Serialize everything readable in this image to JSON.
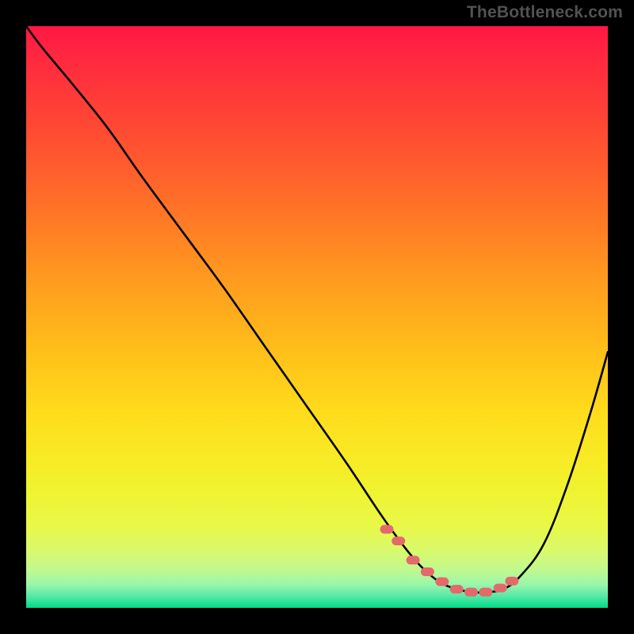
{
  "watermark": "TheBottleneck.com",
  "colors": {
    "page_bg": "#000000",
    "curve": "#000000",
    "marker": "#e36a6a",
    "gradient_top": "#ff1744",
    "gradient_bottom": "#00db87"
  },
  "chart_data": {
    "type": "line",
    "title": "",
    "xlabel": "",
    "ylabel": "",
    "xlim": [
      0,
      100
    ],
    "ylim": [
      0,
      100
    ],
    "grid": false,
    "series": [
      {
        "name": "bottleneck-curve",
        "x": [
          0,
          3,
          8,
          14,
          20,
          27,
          34,
          41,
          48,
          55,
          61,
          65,
          68,
          71,
          74,
          77,
          79,
          82,
          85,
          89,
          93,
          97,
          100
        ],
        "y": [
          100,
          96,
          90,
          82.5,
          74,
          64.5,
          55,
          45,
          35,
          25,
          16,
          10.5,
          7,
          4.5,
          3.2,
          2.7,
          2.7,
          3.2,
          5.5,
          11,
          21,
          33.5,
          44
        ]
      }
    ],
    "markers": {
      "name": "min-region",
      "x": [
        62,
        64,
        66.5,
        69,
        71.5,
        74,
        76.5,
        79,
        81.5,
        83.5
      ],
      "y": [
        13.5,
        11.5,
        8.2,
        6.2,
        4.5,
        3.2,
        2.7,
        2.7,
        3.4,
        4.6
      ]
    }
  }
}
